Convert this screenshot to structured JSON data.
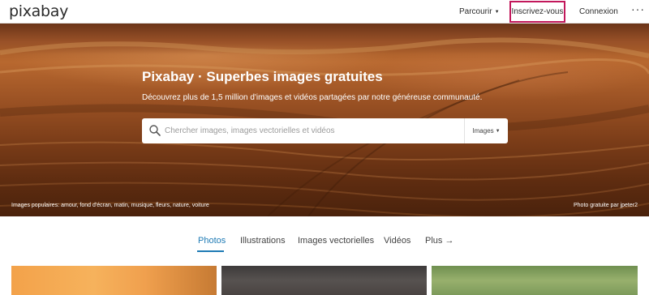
{
  "header": {
    "logo_text": "pixabay",
    "nav": {
      "browse_label": "Parcourir",
      "signup_label": "Inscrivez-vous",
      "login_label": "Connexion",
      "more_label": "···"
    },
    "highlight_color": "#c2185b"
  },
  "hero": {
    "title": "Pixabay · Superbes images gratuites",
    "subtitle": "Découvrez plus de 1,5 million d'images et vidéos partagées par notre généreuse communauté.",
    "search": {
      "placeholder": "Chercher images, images vectorielles et vidéos",
      "value": "",
      "type_label": "Images"
    },
    "popular_text": "Images populaires: amour, fond d'écran, matin, musique, fleurs, nature, voiture",
    "credit_text": "Photo gratuite par jpeter2"
  },
  "tabs": {
    "items": [
      {
        "label": "Photos",
        "active": true
      },
      {
        "label": "Illustrations",
        "active": false
      },
      {
        "label": "Images vectorielles",
        "active": false
      },
      {
        "label": "Vidéos",
        "active": false
      },
      {
        "label": "Plus →",
        "active": false
      }
    ],
    "active_color": "#1f7bb5"
  }
}
